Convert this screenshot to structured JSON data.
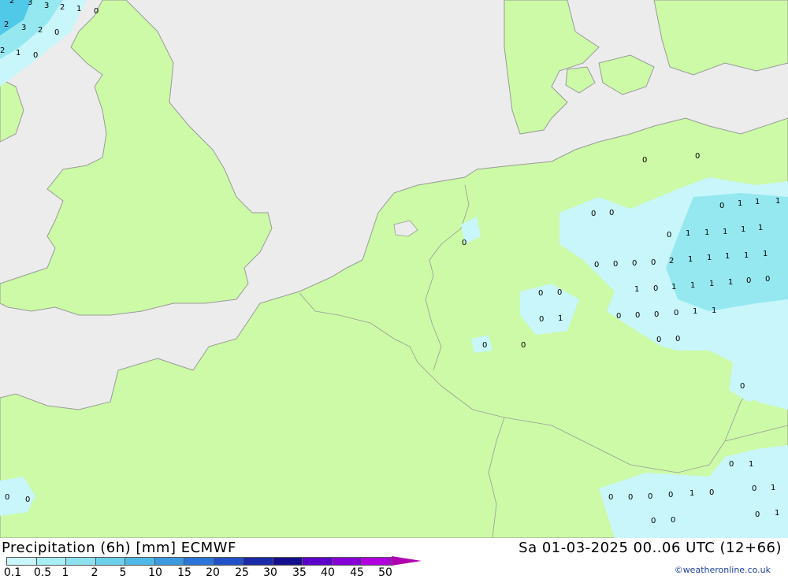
{
  "product": "Precipitation (6h) [mm] ECMWF",
  "valid_time": "Sa 01-03-2025 00..06 UTC (12+66)",
  "credit": "©weatheronline.co.uk",
  "colors": {
    "sea": "#ececec",
    "land": "#ccfaa6",
    "coast": "#9a9a9a",
    "precip_light": "#c8f6fa",
    "precip_medium": "#96e8f0",
    "precip_heavy": "#50c8e8"
  },
  "legend": {
    "ticks": [
      "0.1",
      "0.5",
      "1",
      "2",
      "5",
      "10",
      "15",
      "20",
      "25",
      "30",
      "35",
      "40",
      "45",
      "50"
    ],
    "swatch_colors": [
      "#c8f6fa",
      "#a8eef5",
      "#8ee2f0",
      "#6cd0ea",
      "#50b8e6",
      "#3c9ae0",
      "#2c74d8",
      "#2250c8",
      "#1a2aa8",
      "#14108c",
      "#5a00c8",
      "#8800d8",
      "#b000e0",
      "#e000e8",
      "#d000b0",
      "#b000b0"
    ]
  },
  "precip_values": [
    {
      "v": "2"
    },
    {
      "v": "3"
    },
    {
      "v": "3"
    },
    {
      "v": "2"
    },
    {
      "v": "1"
    },
    {
      "v": "0"
    },
    {
      "v": "2"
    },
    {
      "v": "3"
    },
    {
      "v": "2"
    },
    {
      "v": "0"
    },
    {
      "v": "2"
    },
    {
      "v": "1"
    },
    {
      "v": "0"
    },
    {
      "v": "0"
    },
    {
      "v": "0"
    },
    {
      "v": "0"
    },
    {
      "v": "0"
    },
    {
      "v": "0"
    },
    {
      "v": "1"
    },
    {
      "v": "1"
    },
    {
      "v": "1"
    },
    {
      "v": "0"
    },
    {
      "v": "1"
    },
    {
      "v": "1"
    },
    {
      "v": "1"
    },
    {
      "v": "1"
    },
    {
      "v": "1"
    },
    {
      "v": "0"
    },
    {
      "v": "0"
    },
    {
      "v": "0"
    },
    {
      "v": "0"
    },
    {
      "v": "2"
    },
    {
      "v": "1"
    },
    {
      "v": "1"
    },
    {
      "v": "1"
    },
    {
      "v": "1"
    },
    {
      "v": "1"
    },
    {
      "v": "1"
    },
    {
      "v": "0"
    },
    {
      "v": "1"
    },
    {
      "v": "1"
    },
    {
      "v": "1"
    },
    {
      "v": "1"
    },
    {
      "v": "0"
    },
    {
      "v": "0"
    },
    {
      "v": "0"
    },
    {
      "v": "0"
    },
    {
      "v": "0"
    },
    {
      "v": "0"
    },
    {
      "v": "1"
    },
    {
      "v": "1"
    },
    {
      "v": "0"
    },
    {
      "v": "0"
    },
    {
      "v": "0"
    },
    {
      "v": "1"
    },
    {
      "v": "0"
    },
    {
      "v": "0"
    },
    {
      "v": "0"
    },
    {
      "v": "0"
    },
    {
      "v": "0"
    },
    {
      "v": "0"
    },
    {
      "v": "1"
    },
    {
      "v": "0"
    },
    {
      "v": "0"
    },
    {
      "v": "0"
    },
    {
      "v": "0"
    },
    {
      "v": "0"
    },
    {
      "v": "1"
    },
    {
      "v": "0"
    },
    {
      "v": "0"
    },
    {
      "v": "1"
    },
    {
      "v": "0"
    },
    {
      "v": "1"
    },
    {
      "v": "0"
    },
    {
      "v": "0"
    },
    {
      "v": "0"
    },
    {
      "v": "0"
    }
  ]
}
